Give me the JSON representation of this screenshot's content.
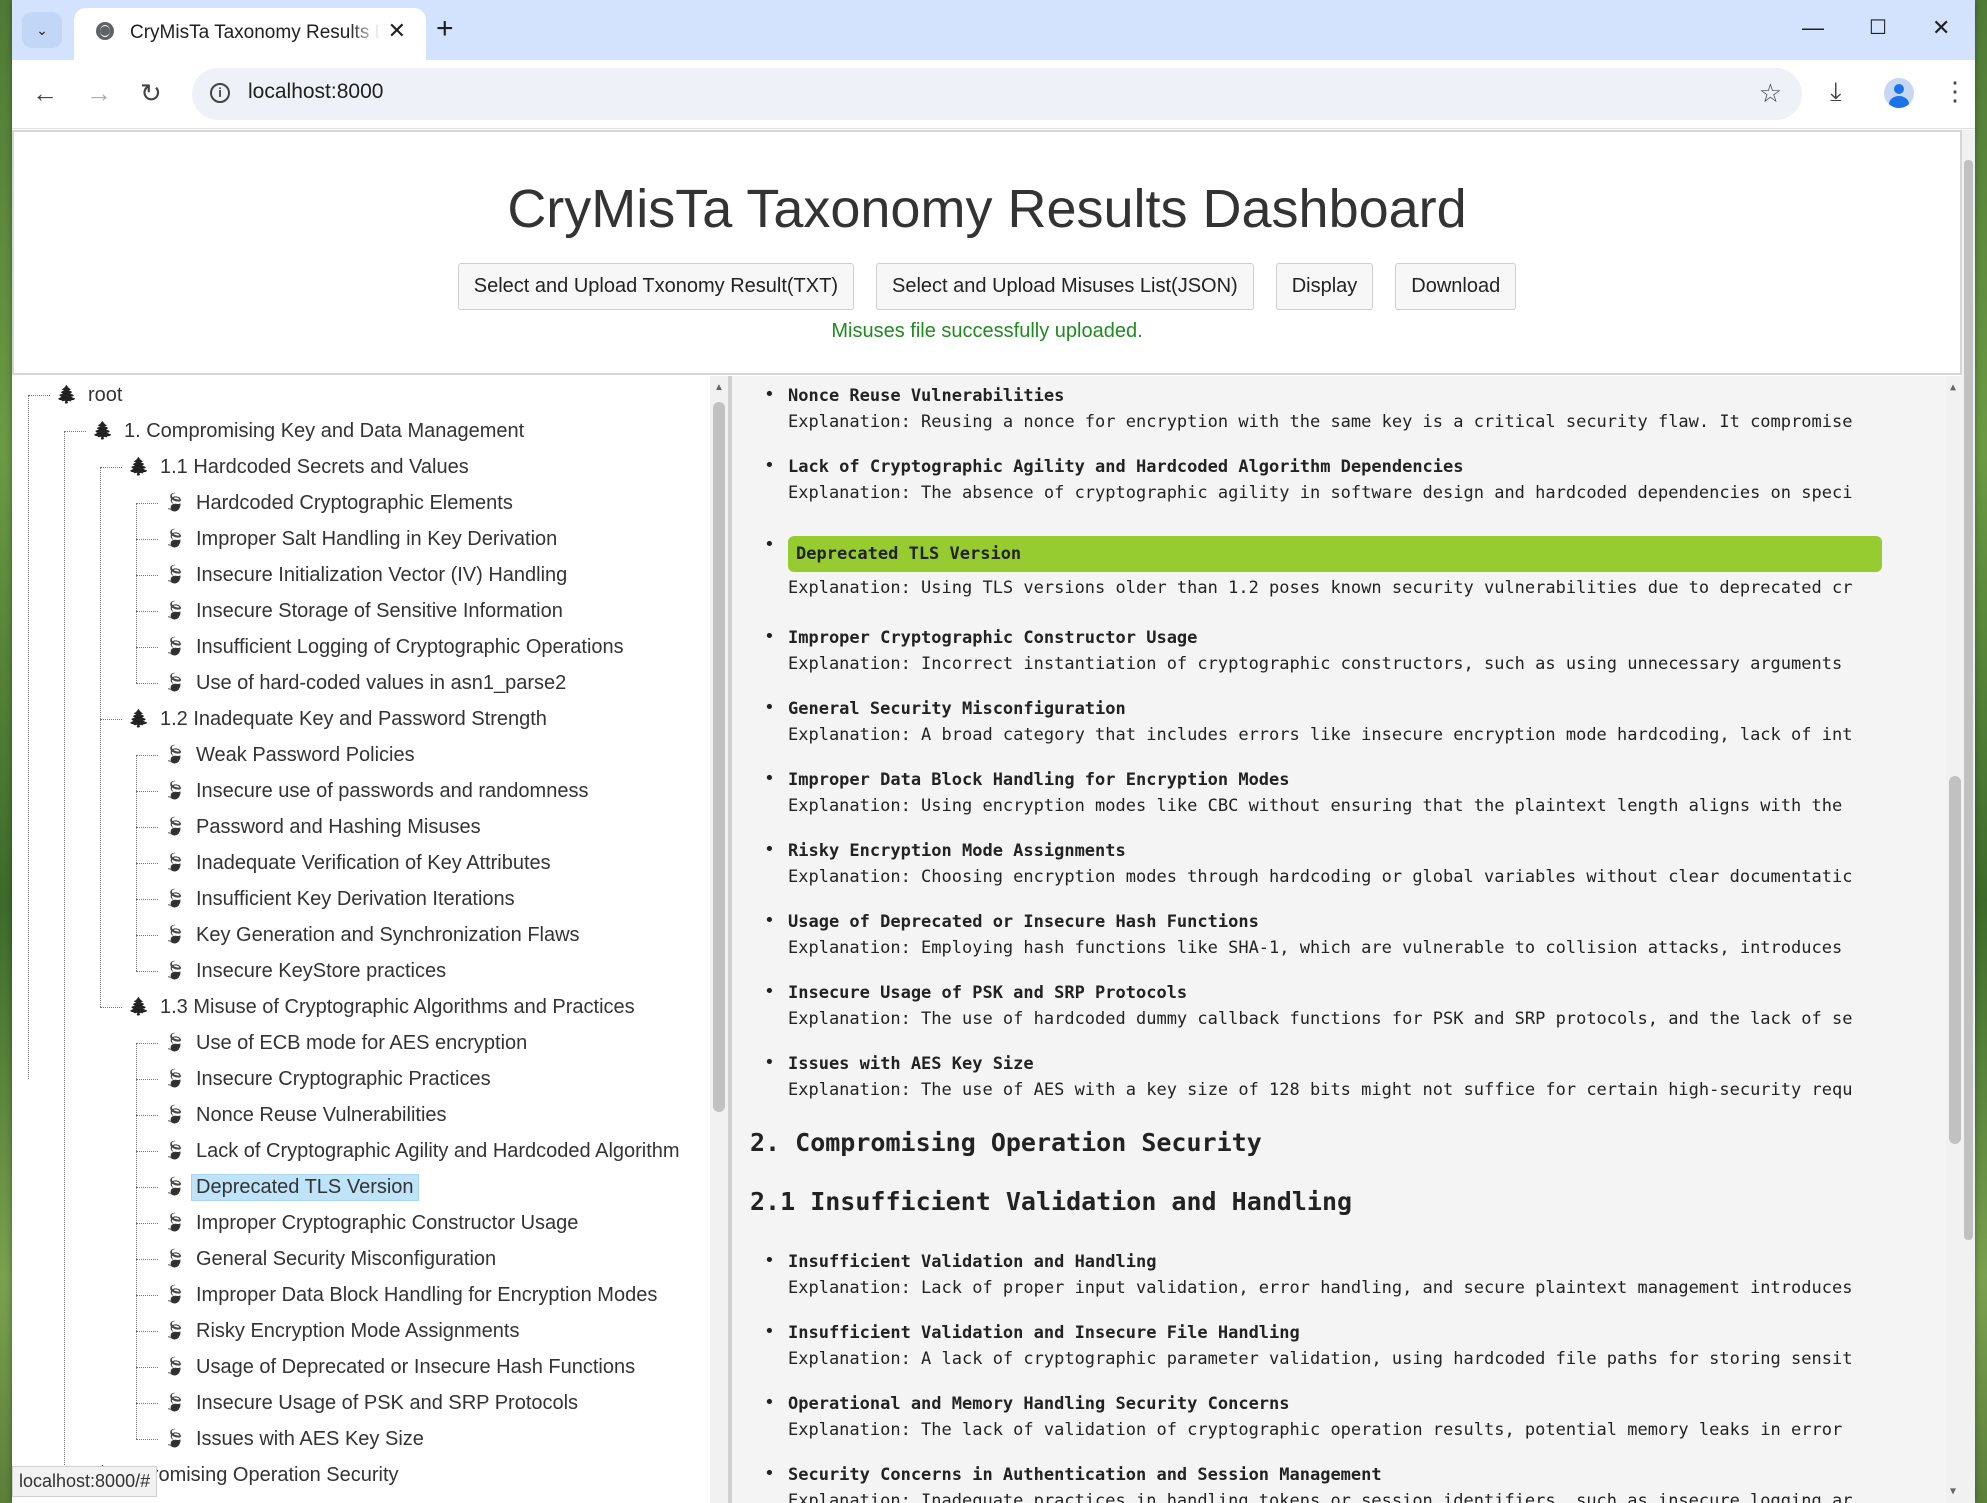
{
  "browser": {
    "tab_title": "CryMisTa Taxonomy Results Dashboard",
    "url": "localhost:8000",
    "status_url": "localhost:8000/#"
  },
  "dashboard": {
    "title": "CryMisTa Taxonomy Results Dashboard",
    "buttons": {
      "upload_txt": "Select and Upload Txonomy Result(TXT)",
      "upload_json": "Select and Upload Misuses List(JSON)",
      "display": "Display",
      "download": "Download"
    },
    "status_message": "Misuses file successfully uploaded."
  },
  "tree": [
    {
      "label": "root",
      "level": 0,
      "icon": "tree-icon"
    },
    {
      "label": "1. Compromising Key and Data Management",
      "level": 1,
      "icon": "tree-icon"
    },
    {
      "label": "1.1 Hardcoded Secrets and Values",
      "level": 2,
      "icon": "tree-icon"
    },
    {
      "label": "Hardcoded Cryptographic Elements",
      "level": 3,
      "icon": "leaf-icon"
    },
    {
      "label": "Improper Salt Handling in Key Derivation",
      "level": 3,
      "icon": "leaf-icon"
    },
    {
      "label": "Insecure Initialization Vector (IV) Handling",
      "level": 3,
      "icon": "leaf-icon"
    },
    {
      "label": "Insecure Storage of Sensitive Information",
      "level": 3,
      "icon": "leaf-icon"
    },
    {
      "label": "Insufficient Logging of Cryptographic Operations",
      "level": 3,
      "icon": "leaf-icon"
    },
    {
      "label": "Use of hard-coded values in asn1_parse2",
      "level": 3,
      "icon": "leaf-icon"
    },
    {
      "label": "1.2 Inadequate Key and Password Strength",
      "level": 2,
      "icon": "tree-icon"
    },
    {
      "label": "Weak Password Policies",
      "level": 3,
      "icon": "leaf-icon"
    },
    {
      "label": "Insecure use of passwords and randomness",
      "level": 3,
      "icon": "leaf-icon"
    },
    {
      "label": "Password and Hashing Misuses",
      "level": 3,
      "icon": "leaf-icon"
    },
    {
      "label": "Inadequate Verification of Key Attributes",
      "level": 3,
      "icon": "leaf-icon"
    },
    {
      "label": "Insufficient Key Derivation Iterations",
      "level": 3,
      "icon": "leaf-icon"
    },
    {
      "label": "Key Generation and Synchronization Flaws",
      "level": 3,
      "icon": "leaf-icon"
    },
    {
      "label": "Insecure KeyStore practices",
      "level": 3,
      "icon": "leaf-icon"
    },
    {
      "label": "1.3 Misuse of Cryptographic Algorithms and Practices",
      "level": 2,
      "icon": "tree-icon"
    },
    {
      "label": "Use of ECB mode for AES encryption",
      "level": 3,
      "icon": "leaf-icon"
    },
    {
      "label": "Insecure Cryptographic Practices",
      "level": 3,
      "icon": "leaf-icon"
    },
    {
      "label": "Nonce Reuse Vulnerabilities",
      "level": 3,
      "icon": "leaf-icon"
    },
    {
      "label": "Lack of Cryptographic Agility and Hardcoded Algorithm",
      "level": 3,
      "icon": "leaf-icon"
    },
    {
      "label": "Deprecated TLS Version",
      "level": 3,
      "icon": "leaf-icon",
      "selected": true
    },
    {
      "label": "Improper Cryptographic Constructor Usage",
      "level": 3,
      "icon": "leaf-icon"
    },
    {
      "label": "General Security Misconfiguration",
      "level": 3,
      "icon": "leaf-icon"
    },
    {
      "label": "Improper Data Block Handling for Encryption Modes",
      "level": 3,
      "icon": "leaf-icon"
    },
    {
      "label": "Risky Encryption Mode Assignments",
      "level": 3,
      "icon": "leaf-icon"
    },
    {
      "label": "Usage of Deprecated or Insecure Hash Functions",
      "level": 3,
      "icon": "leaf-icon"
    },
    {
      "label": "Insecure Usage of PSK and SRP Protocols",
      "level": 3,
      "icon": "leaf-icon"
    },
    {
      "label": "Issues with AES Key Size",
      "level": 3,
      "icon": "leaf-icon"
    },
    {
      "label": "mpromising Operation Security",
      "level": 1,
      "icon": "tree-icon"
    }
  ],
  "content": {
    "items_a": [
      {
        "title": "Nonce Reuse Vulnerabilities",
        "explanation": "Explanation: Reusing a nonce for encryption with the same key is a critical security flaw. It compromise"
      },
      {
        "title": "Lack of Cryptographic Agility and Hardcoded Algorithm Dependencies",
        "explanation": "Explanation: The absence of cryptographic agility in software design and hardcoded dependencies on speci"
      },
      {
        "title": "Deprecated TLS Version",
        "explanation": "Explanation: Using TLS versions older than 1.2 poses known security vulnerabilities due to deprecated cr",
        "highlighted": true
      },
      {
        "title": "Improper Cryptographic Constructor Usage",
        "explanation": "Explanation: Incorrect instantiation of cryptographic constructors, such as using unnecessary arguments"
      },
      {
        "title": "General Security Misconfiguration",
        "explanation": "Explanation: A broad category that includes errors like insecure encryption mode hardcoding, lack of int"
      },
      {
        "title": "Improper Data Block Handling for Encryption Modes",
        "explanation": "Explanation: Using encryption modes like CBC without ensuring that the plaintext length aligns with the"
      },
      {
        "title": "Risky Encryption Mode Assignments",
        "explanation": "Explanation: Choosing encryption modes through hardcoding or global variables without clear documentatic"
      },
      {
        "title": "Usage of Deprecated or Insecure Hash Functions",
        "explanation": "Explanation: Employing hash functions like SHA-1, which are vulnerable to collision attacks, introduces"
      },
      {
        "title": "Insecure Usage of PSK and SRP Protocols",
        "explanation": "Explanation: The use of hardcoded dummy callback functions for PSK and SRP protocols, and the lack of se"
      },
      {
        "title": "Issues with AES Key Size",
        "explanation": "Explanation: The use of AES with a key size of 128 bits might not suffice for certain high-security requ"
      }
    ],
    "section2": "2. Compromising Operation Security",
    "section21": "2.1 Insufficient Validation and Handling",
    "items_b": [
      {
        "title": "Insufficient Validation and Handling",
        "explanation": "Explanation: Lack of proper input validation, error handling, and secure plaintext management introduces"
      },
      {
        "title": "Insufficient Validation and Insecure File Handling",
        "explanation": "Explanation: A lack of cryptographic parameter validation, using hardcoded file paths for storing sensit"
      },
      {
        "title": "Operational and Memory Handling Security Concerns",
        "explanation": "Explanation: The lack of validation of cryptographic operation results, potential memory leaks in error"
      },
      {
        "title": "Security Concerns in Authentication and Session Management",
        "explanation": "Explanation: Inadequate practices in handling tokens or session identifiers, such as insecure logging ar"
      }
    ]
  }
}
